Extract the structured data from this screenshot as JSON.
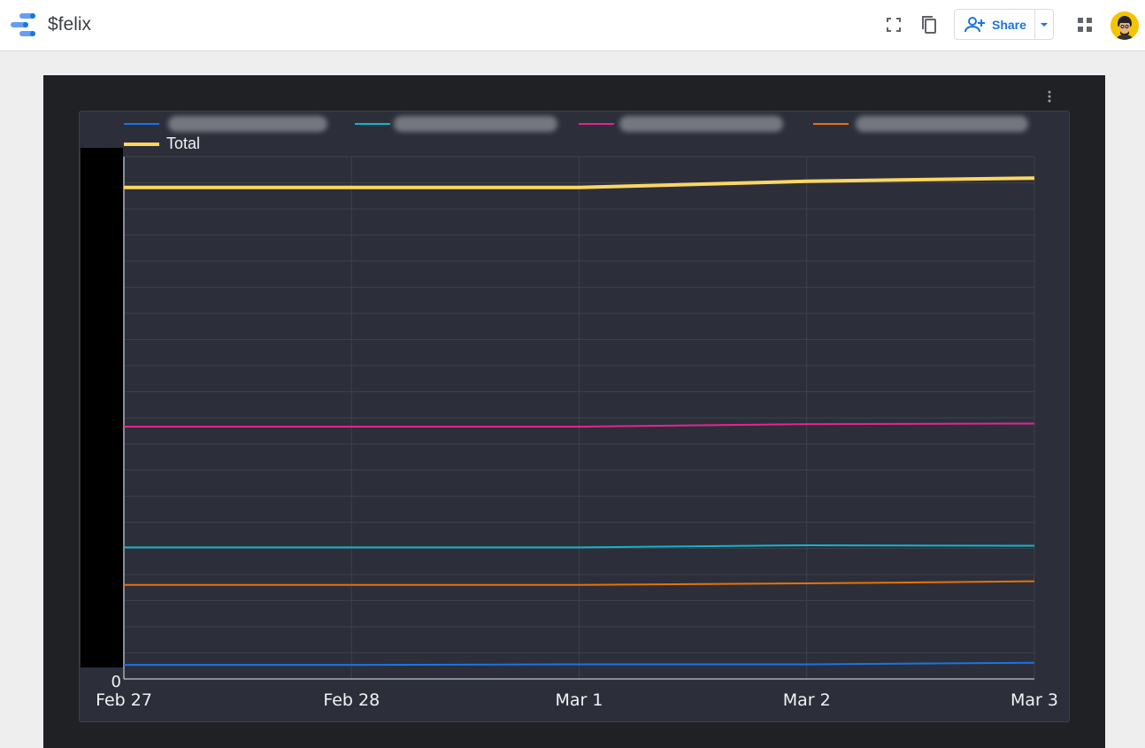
{
  "app": {
    "title": "$felix"
  },
  "toolbar": {
    "fullscreen_icon": "fullscreen-icon",
    "copy_icon": "copy-icon",
    "share_label": "Share",
    "share_icon": "person-add-icon",
    "share_caret_icon": "caret-down-icon",
    "apps_icon": "apps-grid-icon",
    "avatar_icon": "avatar"
  },
  "colors": {
    "accent": "#1a73e8",
    "canvas": "#202124",
    "card": "#2c2f3a",
    "grid": "#3c404b",
    "series_blue": "#1a73e8",
    "series_cyan": "#12b5cb",
    "series_magenta": "#e52592",
    "series_orange": "#e8710a",
    "series_total": "#fdd663"
  },
  "chart_data": {
    "type": "line",
    "title": "",
    "xlabel": "",
    "ylabel": "",
    "x": [
      "Feb 27",
      "Feb 28",
      "Mar 1",
      "Mar 2",
      "Mar 3"
    ],
    "y_tick_labels": [
      "0"
    ],
    "ylim": [
      0,
      100
    ],
    "grid": true,
    "legend_position": "top",
    "series": [
      {
        "color": "#1a73e8",
        "values": [
          2.7,
          2.7,
          2.8,
          2.8,
          3.1
        ]
      },
      {
        "color": "#12b5cb",
        "values": [
          25.2,
          25.2,
          25.2,
          25.6,
          25.5
        ]
      },
      {
        "color": "#e52592",
        "values": [
          48.3,
          48.3,
          48.3,
          48.8,
          48.9
        ]
      },
      {
        "color": "#e8710a",
        "values": [
          18.0,
          18.0,
          18.0,
          18.3,
          18.7
        ]
      },
      {
        "name": "Total",
        "color": "#fdd663",
        "values": [
          94.1,
          94.1,
          94.1,
          95.3,
          95.9
        ]
      }
    ]
  }
}
